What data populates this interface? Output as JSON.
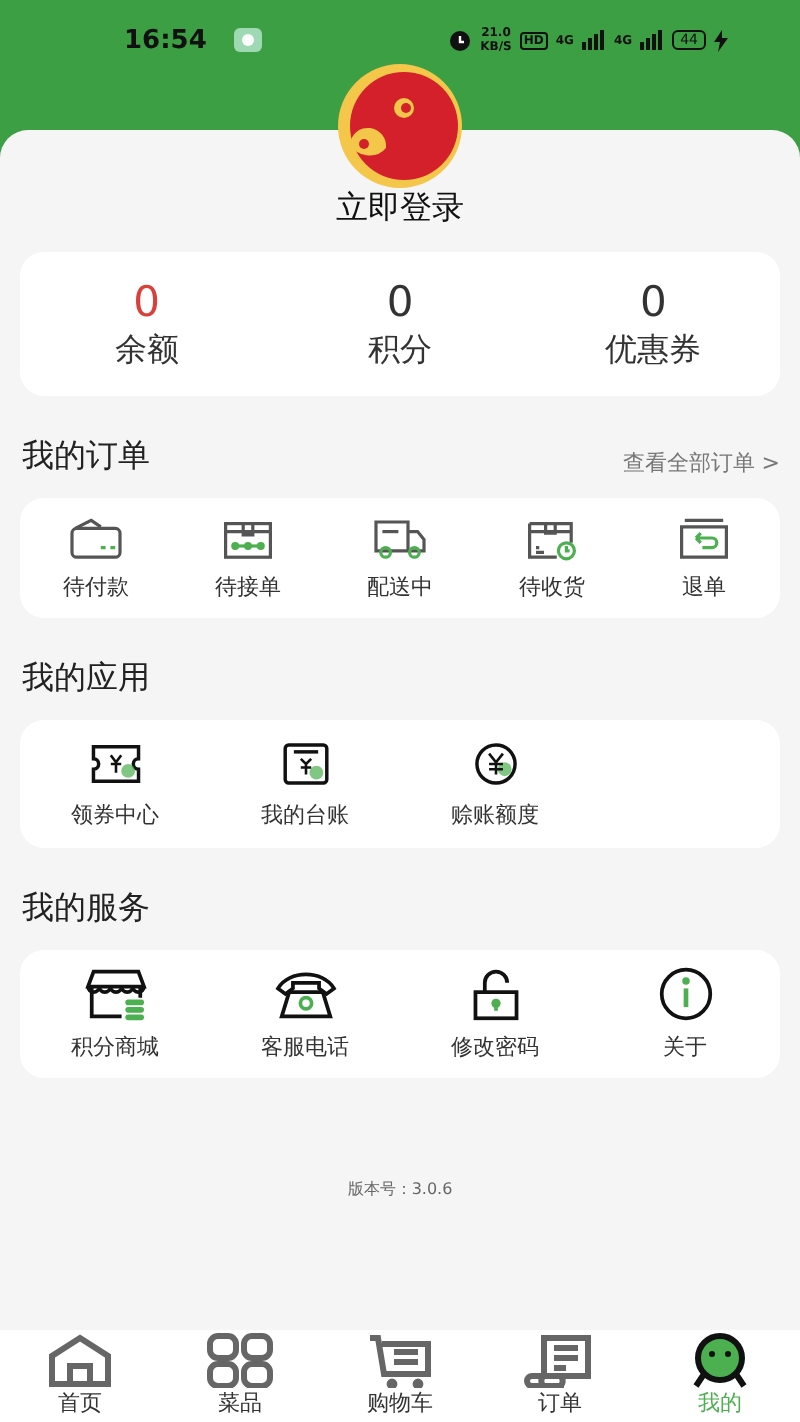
{
  "status_bar": {
    "time": "16:54",
    "speed": "21.0",
    "speed_unit": "KB/S",
    "hd": "HD",
    "signal_1": "4G",
    "signal_2": "4G",
    "battery": "44"
  },
  "profile": {
    "login": "立即登录"
  },
  "stats": [
    {
      "value": "0",
      "label": "余额",
      "color": "#d9403a"
    },
    {
      "value": "0",
      "label": "积分",
      "color": "#333333"
    },
    {
      "value": "0",
      "label": "优惠券",
      "color": "#333333"
    }
  ],
  "orders": {
    "title": "我的订单",
    "view_all": "查看全部订单 >",
    "items": [
      {
        "kind": "card",
        "label": "待付款"
      },
      {
        "kind": "box",
        "label": "待接单"
      },
      {
        "kind": "truck",
        "label": "配送中"
      },
      {
        "kind": "clockbox",
        "label": "待收货"
      },
      {
        "kind": "returnbox",
        "label": "退单"
      }
    ]
  },
  "apps": {
    "title": "我的应用",
    "items": [
      {
        "kind": "ticket",
        "label": "领券中心"
      },
      {
        "kind": "ledger",
        "label": "我的台账"
      },
      {
        "kind": "coin",
        "label": "赊账额度"
      }
    ]
  },
  "services": {
    "title": "我的服务",
    "items": [
      {
        "kind": "shop",
        "label": "积分商城"
      },
      {
        "kind": "phone",
        "label": "客服电话"
      },
      {
        "kind": "lock",
        "label": "修改密码"
      },
      {
        "kind": "info",
        "label": "关于"
      }
    ]
  },
  "version": "版本号：3.0.6",
  "tabs": [
    {
      "kind": "home",
      "label": "首页",
      "selected": false
    },
    {
      "kind": "grid",
      "label": "菜品",
      "selected": false
    },
    {
      "kind": "cart",
      "label": "购物车",
      "selected": false
    },
    {
      "kind": "order",
      "label": "订单",
      "selected": false
    },
    {
      "kind": "me",
      "label": "我的",
      "selected": true
    }
  ]
}
